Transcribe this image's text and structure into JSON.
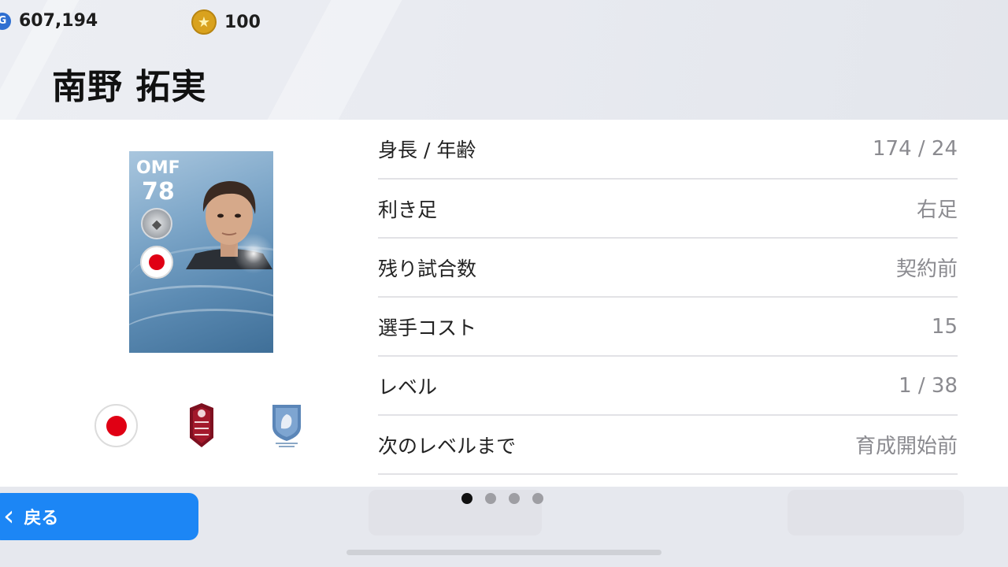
{
  "header": {
    "gp_amount": "607,194",
    "coin_amount": "100",
    "player_name": "南野 拓実"
  },
  "card": {
    "position": "OMF",
    "rating": "78"
  },
  "stats": [
    {
      "label": "身長 / 年齢",
      "value": "174 / 24"
    },
    {
      "label": "利き足",
      "value": "右足"
    },
    {
      "label": "残り試合数",
      "value": "契約前"
    },
    {
      "label": "選手コスト",
      "value": "15"
    },
    {
      "label": "レベル",
      "value": "1 / 38"
    },
    {
      "label": "次のレベルまで",
      "value": "育成開始前"
    }
  ],
  "pagination": {
    "total": 4,
    "current": 1
  },
  "footer": {
    "back_label": "戻る"
  },
  "colors": {
    "accent_blue": "#1c86f5",
    "coin_gold": "#d9a21e",
    "flag_red": "#e00014"
  },
  "icons": [
    "gp-icon",
    "coin-icon",
    "league-badge-icon",
    "japan-flag-icon",
    "club-emblem-icon",
    "league-emblem-icon",
    "chevron-left-icon"
  ]
}
